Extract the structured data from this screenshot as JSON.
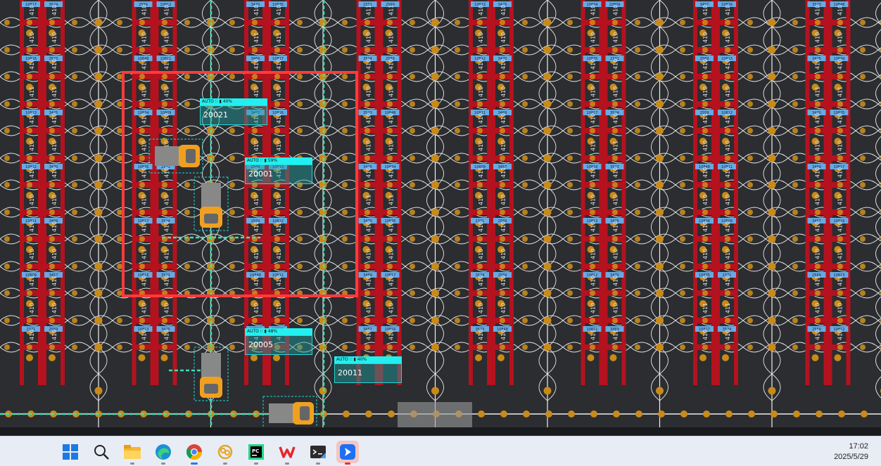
{
  "map": {
    "rack_labels": [
      "410",
      "411",
      "412"
    ],
    "shelf_codes": [
      "10817",
      "10816",
      "10813",
      "10812",
      "10811",
      "10809",
      "2371",
      "3524",
      "3523",
      "3425",
      "3470",
      "3469",
      "3457",
      "2569",
      "2559",
      "10848",
      "10834",
      "10835"
    ],
    "highlight_color": "#ff3b3b",
    "rack_color": "#b3121e",
    "node_color": "#c98a1a",
    "path_color": "#3de0b0"
  },
  "robots": [
    {
      "id": "20021",
      "mode": "AUTO",
      "battery": "40%"
    },
    {
      "id": "20001",
      "mode": "AUTO",
      "battery": "59%"
    },
    {
      "id": "20005",
      "mode": "AUTO",
      "battery": "48%"
    },
    {
      "id": "20011",
      "mode": "AUTO",
      "battery": "40%"
    }
  ],
  "taskbar": {
    "apps": [
      "start-icon",
      "search-icon",
      "file-explorer-icon",
      "edge-icon",
      "chrome-icon",
      "sun-app-icon",
      "pycharm-icon",
      "wps-icon",
      "terminal-icon",
      "feishu-icon"
    ]
  },
  "clock": {
    "time": "17:02",
    "date": "2025/5/29"
  }
}
